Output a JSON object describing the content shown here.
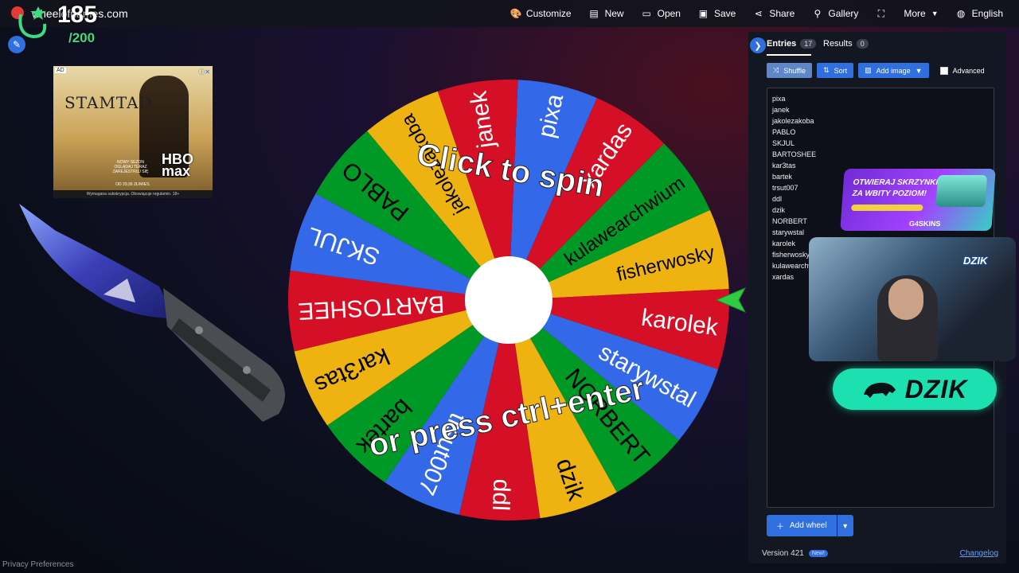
{
  "topbar": {
    "brand": "wheelofnames.com",
    "menu": [
      {
        "id": "customize",
        "label": "Customize",
        "icon": "palette-icon"
      },
      {
        "id": "new",
        "label": "New",
        "icon": "file-icon"
      },
      {
        "id": "open",
        "label": "Open",
        "icon": "folder-open-icon"
      },
      {
        "id": "save",
        "label": "Save",
        "icon": "save-icon"
      },
      {
        "id": "share",
        "label": "Share",
        "icon": "share-icon"
      },
      {
        "id": "gallery",
        "label": "Gallery",
        "icon": "search-icon"
      },
      {
        "id": "fullscreen",
        "label": "",
        "icon": "fullscreen-icon"
      },
      {
        "id": "more",
        "label": "More",
        "icon": "chevron-down-icon"
      },
      {
        "id": "language",
        "label": "English",
        "icon": "globe-icon"
      }
    ]
  },
  "stream_overlay": {
    "count": "185",
    "total": "/200"
  },
  "ad": {
    "tag": "AD",
    "title": "STAMTAD",
    "brand": "HBO max",
    "line1": "NOWY SEZON",
    "line2": "OGLĄDAJ TERAZ",
    "cta": "ZAREJESTRUJ SIĘ",
    "price": "OD 29,99 ZŁ/MIES.",
    "footer": "Wymagana subskrypcja. Obowiązuje regulamin. 18+"
  },
  "wheel": {
    "segments": [
      "pixa",
      "xardas",
      "kulawearchwium",
      "fisherwosky",
      "karolek",
      "starywstal",
      "NORBERT",
      "dzik",
      "ddl",
      "trsut007",
      "bartek",
      "kar3tas",
      "BARTOSHEE",
      "SKJUL",
      "PABLO",
      "jakolezakoba",
      "janek"
    ],
    "colors": [
      "#3369e8",
      "#d50f25",
      "#009925",
      "#eeb211",
      "#d50f25",
      "#3369e8",
      "#009925",
      "#eeb211",
      "#d50f25",
      "#3369e8",
      "#009925",
      "#eeb211",
      "#d50f25",
      "#3369e8",
      "#009925",
      "#eeb211",
      "#d50f25"
    ],
    "text_colors": [
      "#ffffff",
      "#ffffff",
      "#000000",
      "#000000",
      "#ffffff",
      "#ffffff",
      "#000000",
      "#000000",
      "#ffffff",
      "#ffffff",
      "#000000",
      "#000000",
      "#ffffff",
      "#ffffff",
      "#000000",
      "#000000",
      "#ffffff"
    ],
    "hint_top": "Click to spin",
    "hint_bottom": "or press ctrl+enter"
  },
  "panel": {
    "tabs": [
      {
        "label": "Entries",
        "count": "17"
      },
      {
        "label": "Results",
        "count": "0"
      }
    ],
    "tools": {
      "shuffle": "Shuffle",
      "sort": "Sort",
      "add_image": "Add image",
      "advanced": "Advanced"
    },
    "entries": [
      "pixa",
      "janek",
      "jakolezakoba",
      "PABLO",
      "SKJUL",
      "BARTOSHEE",
      "kar3tas",
      "bartek",
      "trsut007",
      "ddl",
      "dzik",
      "NORBERT",
      "starywstal",
      "karolek",
      "fisherwosky",
      "kulawearchwium",
      "xardas"
    ],
    "add_wheel": "Add wheel",
    "version": "Version 421",
    "new_badge": "New!",
    "changelog": "Changelog"
  },
  "sponsor": {
    "line1": "OTWIERAJ SKRZYNKI EXP",
    "line2": "ZA WBITY POZIOM!",
    "brand": "G4SKINS",
    "cam_logo": "DZIK",
    "dzik": "DZIK"
  },
  "footer": {
    "privacy": "Privacy Preferences"
  }
}
